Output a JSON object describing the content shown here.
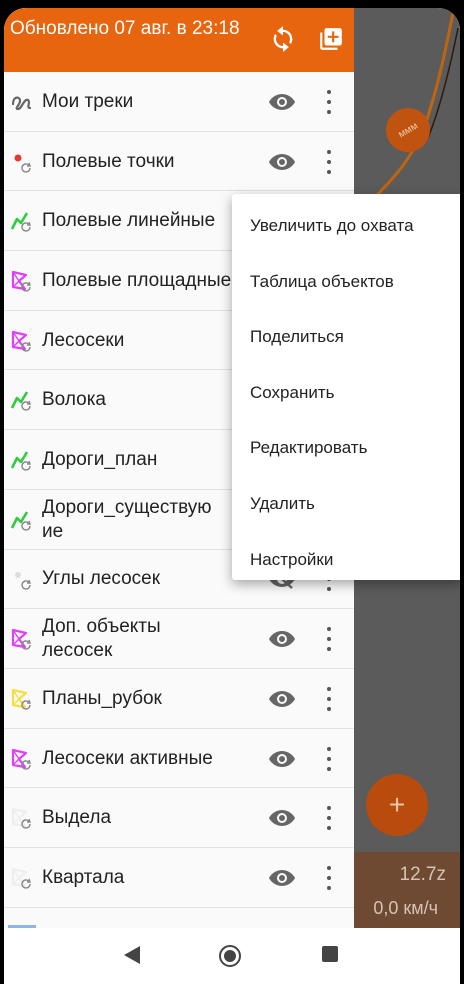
{
  "header": {
    "title": "Обновлено 07 авг. в 23:18",
    "refresh_icon": "refresh-icon",
    "add_icon": "add-layer-icon"
  },
  "layers": [
    {
      "label": "Мои треки",
      "icon": "track-icon",
      "visible": true
    },
    {
      "label": "Полевые точки",
      "icon": "point-layer-icon",
      "visible": true
    },
    {
      "label": "Полевые линейные",
      "icon": "line-layer-icon",
      "visible": true
    },
    {
      "label": "Полевые площадные",
      "icon": "polygon-layer-icon",
      "visible": true
    },
    {
      "label": "Лесосеки",
      "icon": "polygon-layer-icon",
      "visible": true
    },
    {
      "label": "Волока",
      "icon": "line-layer-icon",
      "visible": true
    },
    {
      "label": "Дороги_план",
      "icon": "line-layer-icon",
      "visible": true
    },
    {
      "label": "Дороги_существующие",
      "label_line1": "Дороги_существую",
      "label_line2": "ие",
      "icon": "line-layer-icon",
      "visible": true
    },
    {
      "label": "Углы лесосек",
      "icon": "point-layer-icon",
      "visible": false
    },
    {
      "label": "Доп. объекты лесосек",
      "label_line1": "Доп. объекты",
      "label_line2": "лесосек",
      "icon": "polygon-layer-icon",
      "visible": true
    },
    {
      "label": "Планы_рубок",
      "icon": "polygon-layer-icon",
      "visible": true
    },
    {
      "label": "Лесосеки активные",
      "icon": "polygon-layer-icon",
      "visible": true
    },
    {
      "label": "Выдела",
      "icon": "polygon-layer-icon",
      "visible": true
    },
    {
      "label": "Квартала",
      "icon": "polygon-layer-icon",
      "visible": true
    }
  ],
  "context_menu": [
    "Увеличить до охвата",
    "Таблица объектов",
    "Поделиться",
    "Сохранить",
    "Редактировать",
    "Удалить",
    "Настройки"
  ],
  "map": {
    "zoom": "12.7z",
    "speed": "0,0 км/ч",
    "add_label": "+"
  },
  "colors": {
    "accent": "#e8650f",
    "line_green": "#2ecc40",
    "polygon_magenta": "#e040fb",
    "polygon_yellow": "#f4e03a",
    "point_red": "#e53935"
  }
}
